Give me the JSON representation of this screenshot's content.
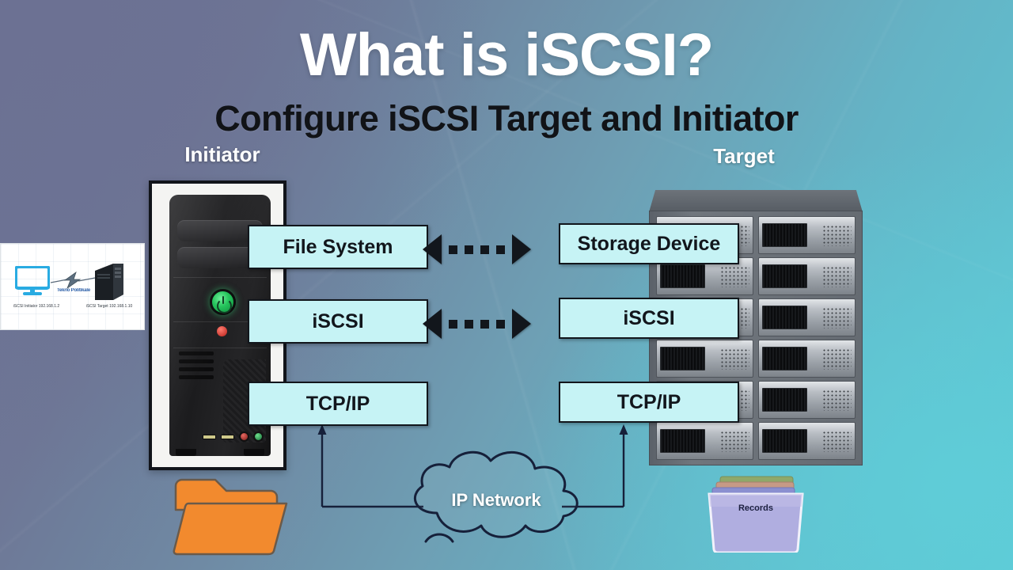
{
  "title": {
    "main": "What is iSCSI?",
    "subtitle": "Configure iSCSI Target and Initiator"
  },
  "labels": {
    "initiator": "Initiator",
    "target": "Target"
  },
  "stack": {
    "initiator": [
      {
        "text": "File System"
      },
      {
        "text": "iSCSI"
      },
      {
        "text": "TCP/IP"
      }
    ],
    "target": [
      {
        "text": "Storage Device"
      },
      {
        "text": "iSCSI"
      },
      {
        "text": "TCP/IP"
      }
    ]
  },
  "network": {
    "cloud_label": "IP Network"
  },
  "storage": {
    "records_label": "Records"
  },
  "inset": {
    "middle_caption": "Tekno Politikale",
    "left_caption": "iSCSI Initiator\n192.168.1.2",
    "right_caption": "iSCSI Target\n192.168.1.10"
  },
  "colors": {
    "box_fill": "#c6f3f5",
    "box_border": "#12161c",
    "bg_start": "#6b7193",
    "bg_end": "#5cc9d6",
    "folder": "#f28a2e",
    "records": "#b0aee0",
    "power_led": "#23c45a"
  }
}
